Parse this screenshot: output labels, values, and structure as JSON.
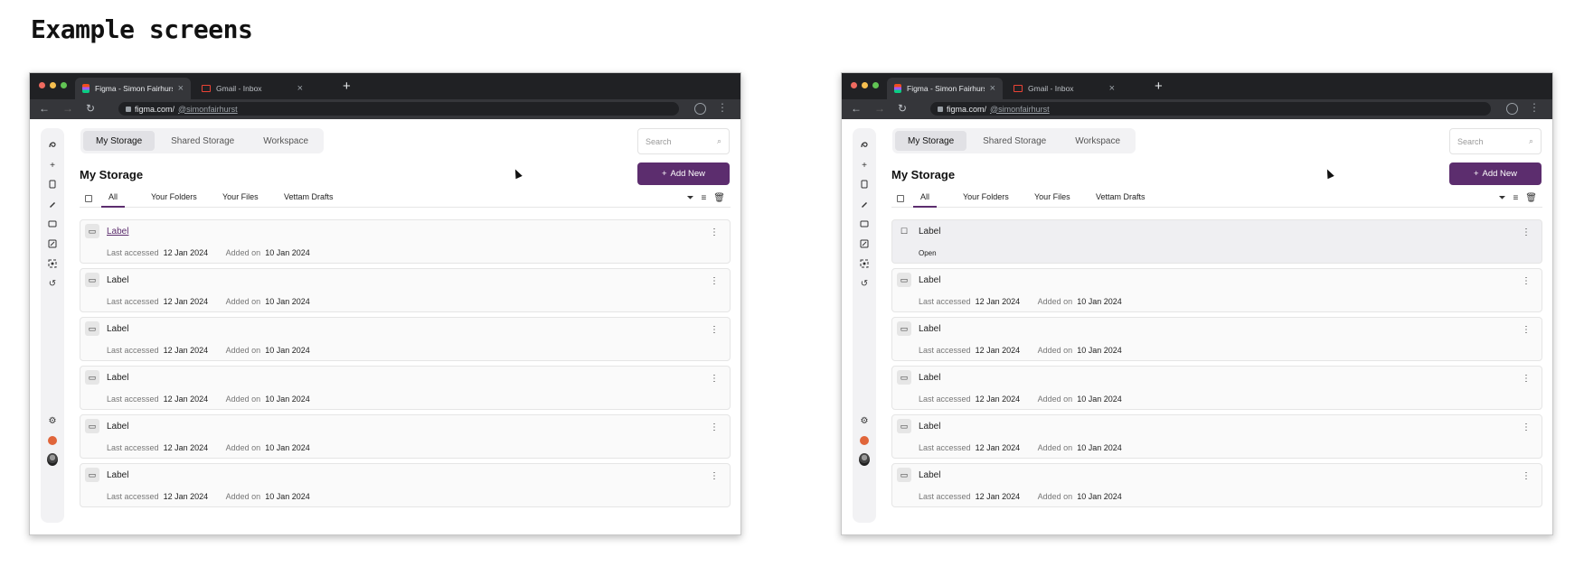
{
  "page": {
    "title": "Example screens"
  },
  "browser": {
    "tabs": [
      {
        "title": "Figma - Simon Fairhurst",
        "icon": "figma-icon"
      },
      {
        "title": "Gmail - Inbox",
        "icon": "gmail-icon"
      }
    ],
    "url_host": "figma.com/",
    "url_path": "@simonfairhurst"
  },
  "app": {
    "segments": [
      "My Storage",
      "Shared Storage",
      "Workspace"
    ],
    "search_placeholder": "Search",
    "heading": "My Storage",
    "add_label": "Add New",
    "filters": [
      "All",
      "Your Folders",
      "Your Files",
      "Vettam Drafts"
    ],
    "last_accessed_label": "Last accessed",
    "added_on_label": "Added on",
    "open_label": "Open",
    "rows": [
      {
        "label": "Label",
        "last_accessed": "12 Jan 2024",
        "added_on": "10 Jan 2024"
      },
      {
        "label": "Label",
        "last_accessed": "12 Jan 2024",
        "added_on": "10 Jan 2024"
      },
      {
        "label": "Label",
        "last_accessed": "12 Jan 2024",
        "added_on": "10 Jan 2024"
      },
      {
        "label": "Label",
        "last_accessed": "12 Jan 2024",
        "added_on": "10 Jan 2024"
      },
      {
        "label": "Label",
        "last_accessed": "12 Jan 2024",
        "added_on": "10 Jan 2024"
      },
      {
        "label": "Label",
        "last_accessed": "12 Jan 2024",
        "added_on": "10 Jan 2024"
      }
    ]
  },
  "colors": {
    "accent": "#5c2d6e",
    "chrome_dark": "#202124",
    "chrome_mid": "#35363a"
  }
}
